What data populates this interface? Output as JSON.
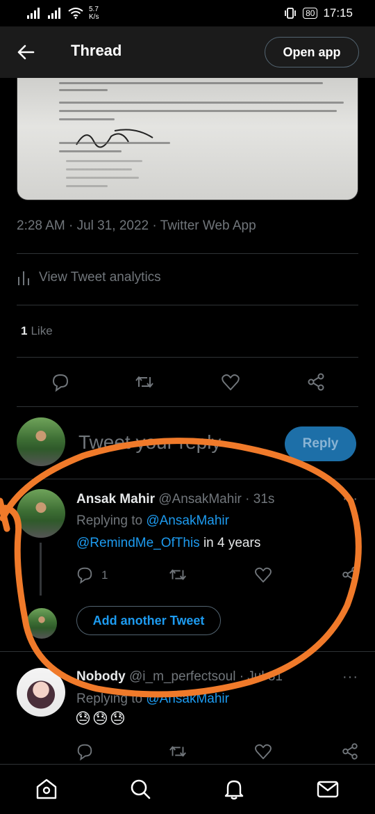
{
  "status_bar": {
    "speed_value": "5.7",
    "speed_unit": "K/s",
    "battery": "80",
    "time": "17:15"
  },
  "header": {
    "title": "Thread",
    "open_app_label": "Open app"
  },
  "main_tweet": {
    "timestamp": "2:28 AM · Jul 31, 2022 · Twitter Web App",
    "analytics_label": "View Tweet analytics",
    "like_count": "1",
    "like_label": "Like"
  },
  "compose": {
    "placeholder": "Tweet your reply",
    "reply_button": "Reply"
  },
  "reply_tweet": {
    "name": "Ansak Mahir",
    "handle": "@AnsakMahir · 31s",
    "replying_prefix": "Replying to",
    "replying_to": "@AnsakMahir",
    "mention": "@RemindMe_OfThis",
    "text_suffix": "in 4 years",
    "reply_count": "1",
    "add_another_label": "Add another Tweet"
  },
  "next_tweet": {
    "name": "Nobody",
    "handle": "@i_m_perfectsoul · Jul 31",
    "replying_prefix": "Replying to",
    "replying_to": "@AnsakMahir",
    "emoji": "😓😓😓"
  },
  "icons": {
    "nav": [
      "home-icon",
      "search-icon",
      "notifications-bell-icon",
      "messages-envelope-icon"
    ],
    "actions": [
      "reply-icon",
      "retweet-icon",
      "like-heart-icon",
      "share-icon"
    ]
  },
  "colors": {
    "accent": "#1d9bf0",
    "annotation": "#f07a2a",
    "muted": "#71767b"
  }
}
